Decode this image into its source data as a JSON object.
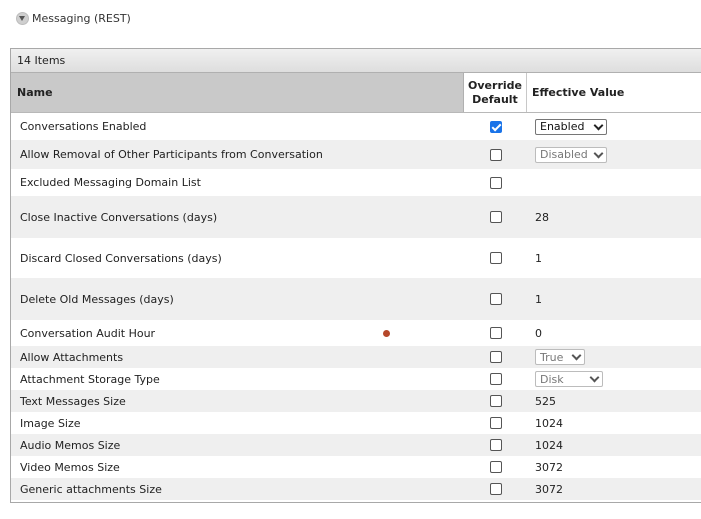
{
  "section": {
    "title": "Messaging (REST)",
    "toggle_icon": "collapse-arrow-icon"
  },
  "table": {
    "item_count": "14 Items",
    "headers": {
      "name": "Name",
      "override_line1": "Override",
      "override_line2": "Default",
      "value": "Effective Value"
    },
    "rows": [
      {
        "name": "Conversations Enabled",
        "override": true,
        "value": "Enabled",
        "value_type": "select",
        "disabled": false,
        "alt": false,
        "height": 27
      },
      {
        "name": "Allow Removal of Other Participants from Conversation",
        "override": false,
        "value": "Disabled",
        "value_type": "select",
        "disabled": true,
        "alt": true,
        "height": 29
      },
      {
        "name": "Excluded Messaging Domain List",
        "override": false,
        "value": "",
        "value_type": "text",
        "alt": false,
        "height": 27
      },
      {
        "name": "Close Inactive Conversations (days)",
        "override": false,
        "value": "28",
        "value_type": "text",
        "alt": true,
        "height": 42
      },
      {
        "name": "Discard Closed Conversations (days)",
        "override": false,
        "value": "1",
        "value_type": "text",
        "alt": false,
        "height": 40
      },
      {
        "name": "Delete Old Messages (days)",
        "override": false,
        "value": "1",
        "value_type": "text",
        "alt": true,
        "height": 42
      },
      {
        "name": "Conversation Audit Hour",
        "override": false,
        "value": "0",
        "value_type": "text",
        "alt": false,
        "height": 26,
        "marker": true
      },
      {
        "name": "Allow Attachments",
        "override": false,
        "value": "True",
        "value_type": "select",
        "disabled": true,
        "alt": true,
        "height": 22
      },
      {
        "name": "Attachment Storage Type",
        "override": false,
        "value": "Disk",
        "value_type": "select",
        "disabled": true,
        "alt": false,
        "height": 22
      },
      {
        "name": "Text Messages Size",
        "override": false,
        "value": "525",
        "value_type": "text",
        "alt": true,
        "height": 22
      },
      {
        "name": "Image Size",
        "override": false,
        "value": "1024",
        "value_type": "text",
        "alt": false,
        "height": 22
      },
      {
        "name": "Audio Memos Size",
        "override": false,
        "value": "1024",
        "value_type": "text",
        "alt": true,
        "height": 22
      },
      {
        "name": "Video Memos Size",
        "override": false,
        "value": "3072",
        "value_type": "text",
        "alt": false,
        "height": 22
      },
      {
        "name": "Generic attachments Size",
        "override": false,
        "value": "3072",
        "value_type": "text",
        "alt": true,
        "height": 22
      }
    ]
  },
  "colors": {
    "marker_dot": "#b5472a",
    "checkbox_checked": "#1a73e8"
  }
}
